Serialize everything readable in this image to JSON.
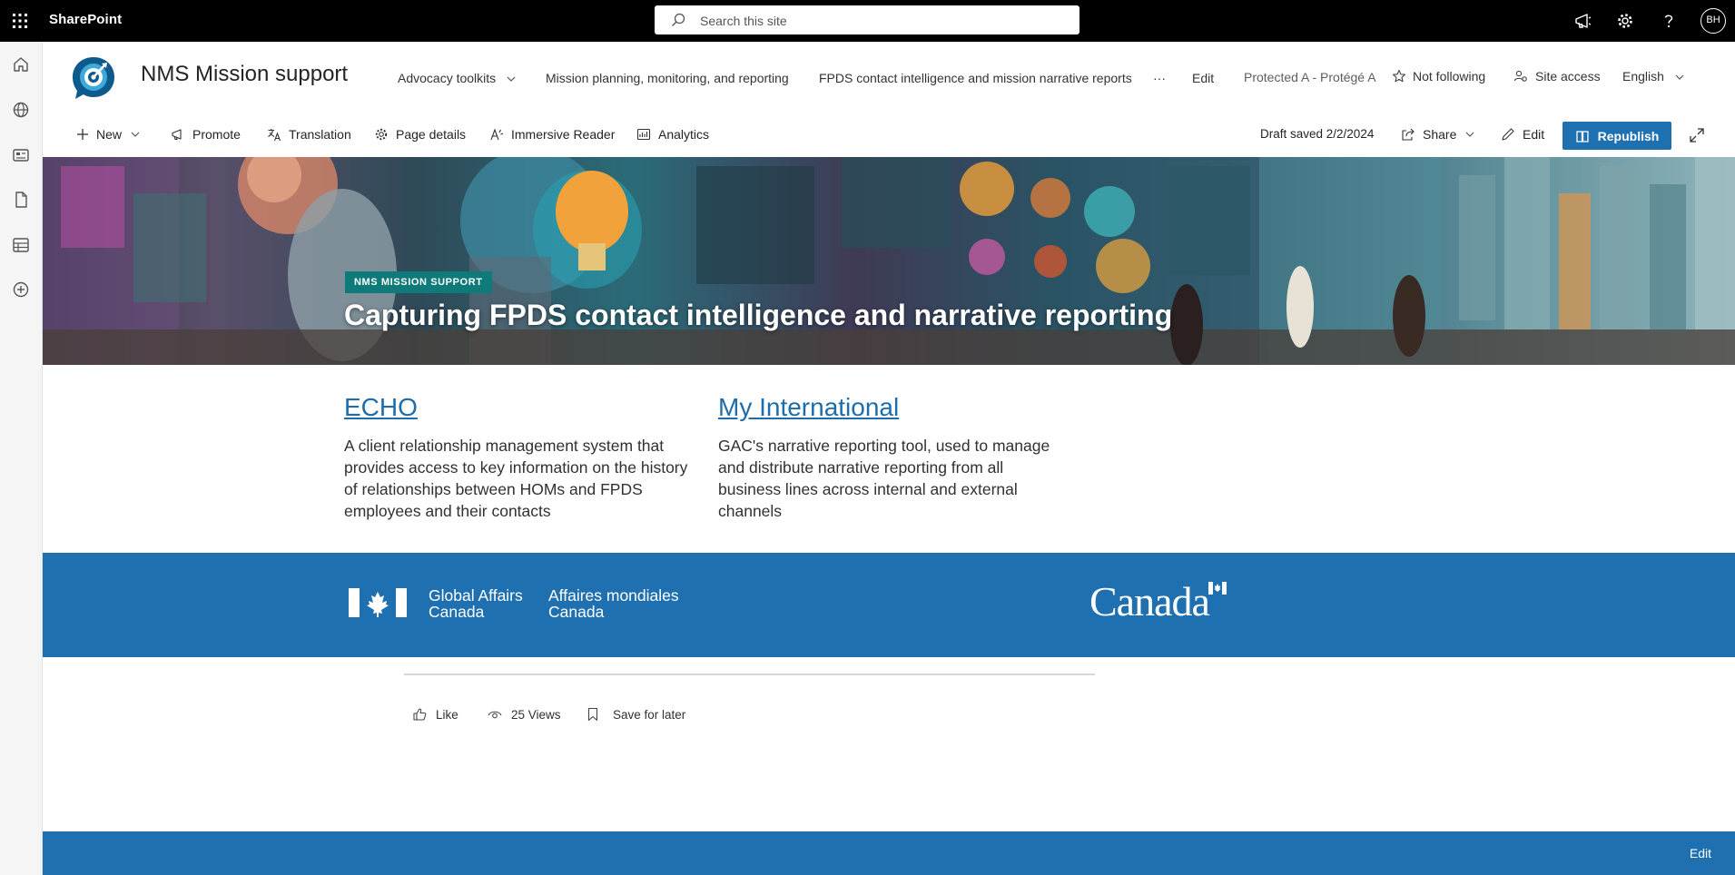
{
  "suite": {
    "app_name": "SharePoint",
    "search_placeholder": "Search this site",
    "avatar_initials": "BH",
    "icons": [
      "waffle-icon",
      "megaphone-icon",
      "gear-icon",
      "help-icon"
    ]
  },
  "site": {
    "title": "NMS Mission support",
    "nav": [
      {
        "label": "Advocacy toolkits",
        "has_dropdown": true
      },
      {
        "label": "Mission planning, monitoring, and reporting"
      },
      {
        "label": "FPDS contact intelligence and mission narrative reports"
      },
      {
        "label": "···"
      },
      {
        "label": "Edit"
      }
    ],
    "classification": "Protected A - Protégé A",
    "follow_label": "Not following",
    "access_label": "Site access",
    "language": "English"
  },
  "commands": {
    "new": "New",
    "promote": "Promote",
    "translation": "Translation",
    "page_details": "Page details",
    "immersive_reader": "Immersive Reader",
    "analytics": "Analytics",
    "draft_status": "Draft saved 2/2/2024",
    "share": "Share",
    "edit": "Edit",
    "republish": "Republish"
  },
  "hero": {
    "badge": "NMS MISSION SUPPORT",
    "title": "Capturing FPDS contact intelligence and narrative reporting"
  },
  "links": [
    {
      "title": "ECHO",
      "description": "A client relationship management system that provides access to key information on the history of relationships between HOMs and FPDS employees and their contacts"
    },
    {
      "title": "My International",
      "description": "GAC's narrative reporting tool, used to manage and distribute narrative reporting from all business lines across internal and external channels"
    }
  ],
  "banner": {
    "dept_en_1": "Global Affairs",
    "dept_en_2": "Canada",
    "dept_fr_1": "Affaires mondiales",
    "dept_fr_2": "Canada",
    "wordmark": "Canada"
  },
  "social": {
    "like": "Like",
    "views": "25 Views",
    "save": "Save for later"
  },
  "footer": {
    "edit": "Edit"
  },
  "colors": {
    "accent": "#1f70b0",
    "badge": "#0e7a7a",
    "link": "#1d6cab"
  }
}
